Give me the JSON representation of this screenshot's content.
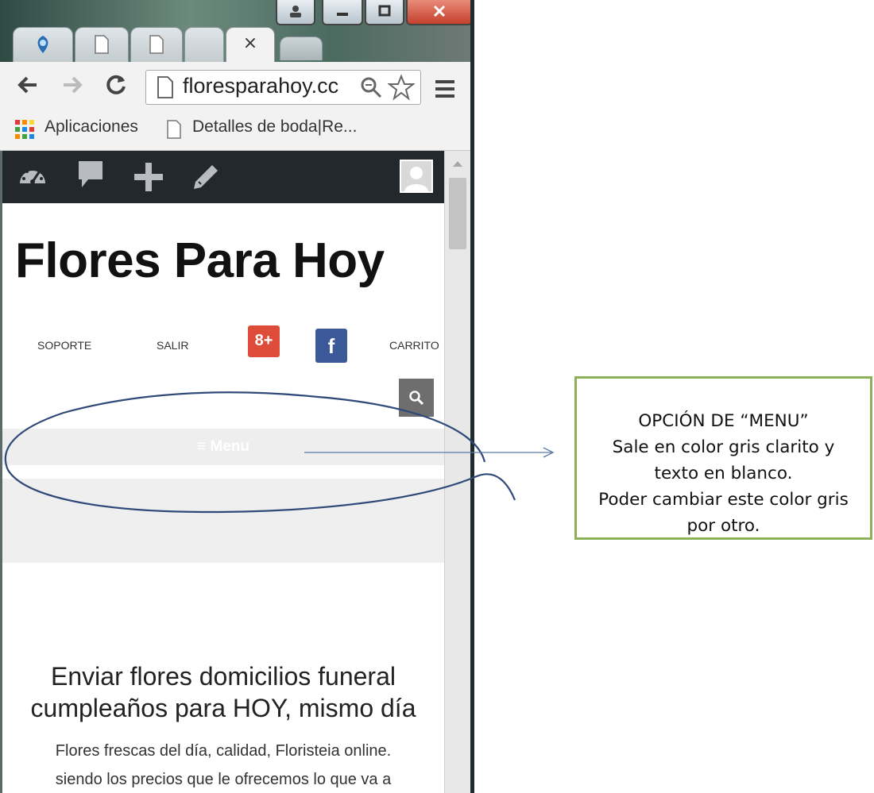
{
  "browser": {
    "tab_close_glyph": "×",
    "address_url": "floresparahoy.cc",
    "bookmarks": {
      "apps_label": "Aplicaciones",
      "bookmark_1": "Detalles de boda|Re..."
    }
  },
  "site": {
    "title": "Flores Para Hoy",
    "nav": {
      "soporte": "SOPORTE",
      "salir": "SALIR",
      "carrito": "CARRITO"
    },
    "social": {
      "google_plus_glyph": "8+",
      "facebook_glyph": "f"
    },
    "menu_label": "≡ Menu",
    "headline_line1": "Enviar flores domicilios funeral",
    "headline_line2": "cumpleaños para HOY, mismo día",
    "body_line1": "Flores frescas del día, calidad, Floristeia online.",
    "body_line2": "siendo los precios que le ofrecemos lo que va a"
  },
  "annotation": {
    "line1": "OPCIÓN DE “MENU”",
    "line2": "Sale en color gris clarito y",
    "line3": "texto en blanco.",
    "line4": "Poder cambiar este color gris",
    "line5": "por otro."
  },
  "colors": {
    "annotation_border": "#8db05a",
    "wp_admin_bar": "#23282d",
    "menu_bar": "#eeeeee",
    "google_plus": "#dd4b39",
    "facebook": "#3b5998",
    "ink_circle": "#2f4a78"
  },
  "icons": {
    "dashboard": "dashboard-icon",
    "comment": "comment-icon",
    "add": "plus-icon",
    "edit": "pencil-icon",
    "user": "avatar-icon",
    "search": "search-icon"
  }
}
